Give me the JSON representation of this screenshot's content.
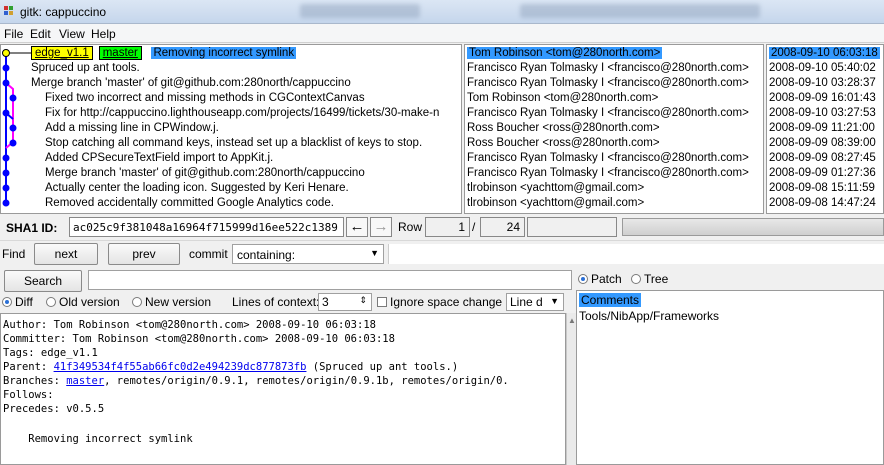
{
  "window": {
    "title": "gitk: cappuccino"
  },
  "menu": [
    "File",
    "Edit",
    "View",
    "Help"
  ],
  "commits": [
    {
      "refs": {
        "tag": "edge_v1.1",
        "head": "master"
      },
      "message": "Removing incorrect symlink",
      "author": "Tom Robinson <tom@280north.com>",
      "date": "2008-09-10 06:03:18",
      "selected": true
    },
    {
      "message": "Spruced up ant tools.",
      "author": "Francisco Ryan Tolmasky I <francisco@280north.com>",
      "date": "2008-09-10 05:40:02"
    },
    {
      "message": "Merge branch 'master' of git@github.com:280north/cappuccino",
      "author": "Francisco Ryan Tolmasky I <francisco@280north.com>",
      "date": "2008-09-10 03:28:37"
    },
    {
      "message": "Fixed two incorrect and missing methods in CGContextCanvas",
      "author": "Tom Robinson <tom@280north.com>",
      "date": "2008-09-09 16:01:43"
    },
    {
      "message": "Fix for http://cappuccino.lighthouseapp.com/projects/16499/tickets/30-make-n",
      "author": "Francisco Ryan Tolmasky I <francisco@280north.com>",
      "date": "2008-09-10 03:27:53"
    },
    {
      "message": "Add a missing line in CPWindow.j.",
      "author": "Ross Boucher <ross@280north.com>",
      "date": "2008-09-09 11:21:00"
    },
    {
      "message": "Stop catching all command keys, instead set up a blacklist of keys to stop.",
      "author": "Ross Boucher <ross@280north.com>",
      "date": "2008-09-09 08:39:00"
    },
    {
      "message": "Added CPSecureTextField import to AppKit.j.",
      "author": "Francisco Ryan Tolmasky I <francisco@280north.com>",
      "date": "2008-09-09 08:27:45"
    },
    {
      "message": "Merge branch 'master' of git@github.com:280north/cappuccino",
      "author": "Francisco Ryan Tolmasky I <francisco@280north.com>",
      "date": "2008-09-09 01:27:36"
    },
    {
      "message": "Actually center the loading icon. Suggested by Keri Henare.",
      "author": "tlrobinson <yachttom@gmail.com>",
      "date": "2008-09-08 15:11:59"
    },
    {
      "message": "Removed accidentally committed Google Analytics code.",
      "author": "tlrobinson <yachttom@gmail.com>",
      "date": "2008-09-08 14:47:24"
    }
  ],
  "sha": {
    "label": "SHA1 ID:",
    "value": "ac025c9f381048a16964f715999d16ee522c1389"
  },
  "row": {
    "label": "Row",
    "current": "1",
    "sep": "/",
    "total": "24"
  },
  "find": {
    "label": "Find",
    "next": "next",
    "prev": "prev",
    "commit_label": "commit",
    "mode": "containing:"
  },
  "search": {
    "button": "Search"
  },
  "diff_options": {
    "diff": "Diff",
    "old": "Old version",
    "new": "New version",
    "context_label": "Lines of context:",
    "context_value": "3",
    "ignore_space": "Ignore space change",
    "line_mode": "Line d"
  },
  "diff_text": {
    "author": "Author: Tom Robinson <tom@280north.com>  2008-09-10 06:03:18",
    "committer": "Committer: Tom Robinson <tom@280north.com>  2008-09-10 06:03:18",
    "tags": "Tags: edge_v1.1",
    "parent_label": "Parent: ",
    "parent_hash": "41f349534f4f55ab66fc0d2e494239dc877873fb",
    "parent_msg": " (Spruced up ant tools.)",
    "branches_label": "Branches: ",
    "branches_master": "master",
    "branches_rest": ", remotes/origin/0.9.1, remotes/origin/0.9.1b, remotes/origin/0.",
    "follows": "Follows:",
    "precedes": "Precedes: v0.5.5",
    "message": "    Removing incorrect symlink"
  },
  "right_pane": {
    "patch": "Patch",
    "tree": "Tree",
    "files": [
      "Comments",
      "Tools/NibApp/Frameworks"
    ]
  },
  "colors": {
    "selection": "#3399ff",
    "tag": "#ffff00",
    "head": "#00ff00",
    "link": "#0000ee"
  }
}
